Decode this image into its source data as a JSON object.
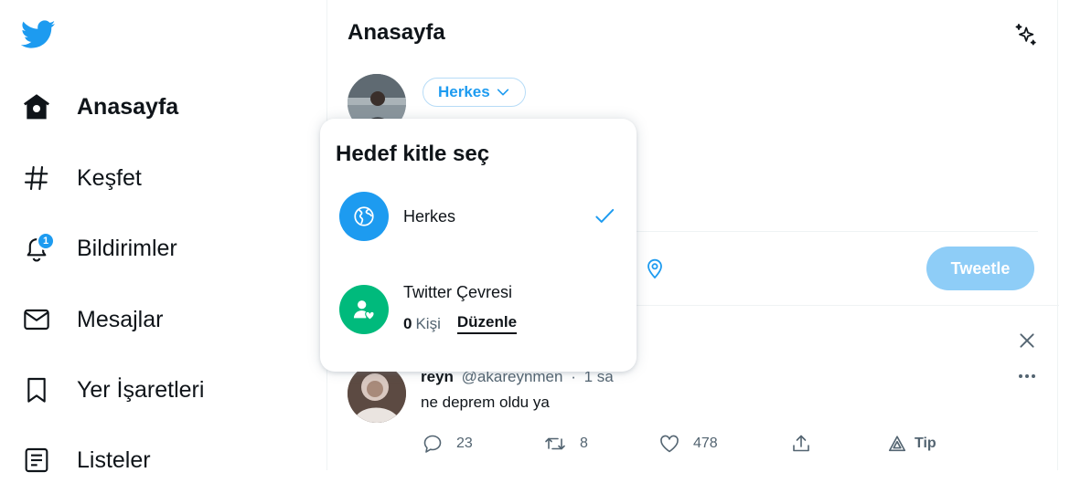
{
  "colors": {
    "accent": "#1d9bf0",
    "accent_light": "#8ecdf7",
    "green": "#00ba7c",
    "text": "#0f1419",
    "muted": "#536471"
  },
  "sidebar": {
    "logo_icon": "twitter-bird-icon",
    "items": [
      {
        "label": "Anasayfa",
        "icon": "home-icon",
        "active": true
      },
      {
        "label": "Keşfet",
        "icon": "hashtag-icon",
        "active": false
      },
      {
        "label": "Bildirimler",
        "icon": "bell-icon",
        "badge": "1",
        "active": false
      },
      {
        "label": "Mesajlar",
        "icon": "envelope-icon",
        "active": false
      },
      {
        "label": "Yer İşaretleri",
        "icon": "bookmark-icon",
        "active": false
      },
      {
        "label": "Listeler",
        "icon": "list-icon",
        "active": false
      }
    ]
  },
  "header": {
    "title": "Anasayfa",
    "sparkle_icon": "sparkle-icon"
  },
  "composer": {
    "audience_label": "Herkes",
    "tweet_button": "Tweetle"
  },
  "audience_popover": {
    "title": "Hedef kitle seç",
    "options": [
      {
        "label": "Herkes",
        "icon": "globe-icon",
        "selected": true
      },
      {
        "label": "Twitter Çevresi",
        "icon": "people-heart-icon",
        "count": "0",
        "count_unit": "Kişi",
        "edit_label": "Düzenle"
      }
    ]
  },
  "tweet": {
    "name": "reyn",
    "handle": "@akareynmen",
    "separator": "·",
    "time": "1 sa",
    "text": "ne deprem oldu ya",
    "replies": "23",
    "retweets": "8",
    "likes": "478",
    "tip_label": "Tip"
  }
}
